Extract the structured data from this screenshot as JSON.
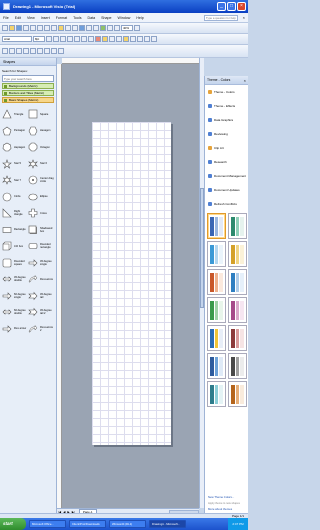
{
  "window": {
    "title": "Drawing1 - Microsoft Visio (Trial)"
  },
  "menu": {
    "items": [
      "File",
      "Edit",
      "View",
      "Insert",
      "Format",
      "Tools",
      "Data",
      "Shape",
      "Window",
      "Help"
    ],
    "help_placeholder": "Type a question for help"
  },
  "toolbar": {
    "font": "Arial",
    "size": "8pt",
    "zoom": "40%"
  },
  "shapes_panel": {
    "title": "Shapes",
    "search_label": "Search for Shapes:",
    "search_placeholder": "Type your search here",
    "stencils": [
      "Backgrounds (Metric)",
      "Borders and Titles (Metric)",
      "Basic Shapes (Metric)"
    ],
    "items": [
      "Triangle",
      "Square",
      "Pentagon",
      "Hexagon",
      "Heptagon",
      "Octagon",
      "Star 5",
      "Star 6",
      "Star 7",
      "Center drag circle",
      "Circle",
      "Ellipse",
      "Right triangle",
      "Cross",
      "Rectangle",
      "Shadowed box",
      "3-D box",
      "Rounded rectangle",
      "Rounded square",
      "45 degree single",
      "45 degree double",
      "Flexi-arrow",
      "60 degree single",
      "45 degree tail",
      "60 degree double",
      "45 degree tail 2",
      "Flex arrow",
      "Flexi-arrow 2"
    ]
  },
  "page_tabs": {
    "active": "Page-1"
  },
  "task_pane": {
    "title": "Theme - Colors",
    "links": [
      "Theme - Colors",
      "Theme - Effects",
      "Data Graphics",
      "Reviewing",
      "Clip Art",
      "Research",
      "Document Management",
      "Document Updates",
      "Refresh Conflicts"
    ],
    "swatches": [
      {
        "colors": [
          "#3b66b3",
          "#9bb7e0",
          "#e2e9f6"
        ]
      },
      {
        "colors": [
          "#2d8a6e",
          "#8fd1b9",
          "#e6f3ee"
        ]
      },
      {
        "colors": [
          "#3c9ad6",
          "#b3d7f0",
          "#eaf4fb"
        ]
      },
      {
        "colors": [
          "#d4a12a",
          "#f1d685",
          "#fbf2d8"
        ]
      },
      {
        "colors": [
          "#c9582a",
          "#efb38f",
          "#fbe9dd"
        ]
      },
      {
        "colors": [
          "#2f7fc1",
          "#aecdea",
          "#e6f0fa"
        ]
      },
      {
        "colors": [
          "#3a9a4a",
          "#9fd3a6",
          "#e8f5ea"
        ]
      },
      {
        "colors": [
          "#a64a8a",
          "#dba9cc",
          "#f6e6f1"
        ]
      },
      {
        "colors": [
          "#2b6cb5",
          "#f0c437",
          "#e8eef8"
        ]
      },
      {
        "colors": [
          "#8c3a3a",
          "#d99b9b",
          "#f6e4e4"
        ]
      },
      {
        "colors": [
          "#2f5c9e",
          "#6fa3d9",
          "#dfeaf7"
        ]
      },
      {
        "colors": [
          "#4a4a4a",
          "#a0a0a0",
          "#ececec"
        ]
      },
      {
        "colors": [
          "#2e7d8c",
          "#8ccfd8",
          "#e4f3f5"
        ]
      },
      {
        "colors": [
          "#b5651d",
          "#e8b07a",
          "#f9ebdc"
        ]
      }
    ],
    "new_theme": "New Theme Colors...",
    "apply_note": "Apply theme to new shapes",
    "more_link": "More about themes"
  },
  "status": {
    "page_info": "Page 1/1"
  },
  "taskbar": {
    "start": "start",
    "buttons": [
      "Microsoft Office...",
      "Client/Prot/Downloads",
      "Winword4 (DL1)",
      "Drawing1 - Microsoft..."
    ],
    "clock": "2:47 PM"
  }
}
